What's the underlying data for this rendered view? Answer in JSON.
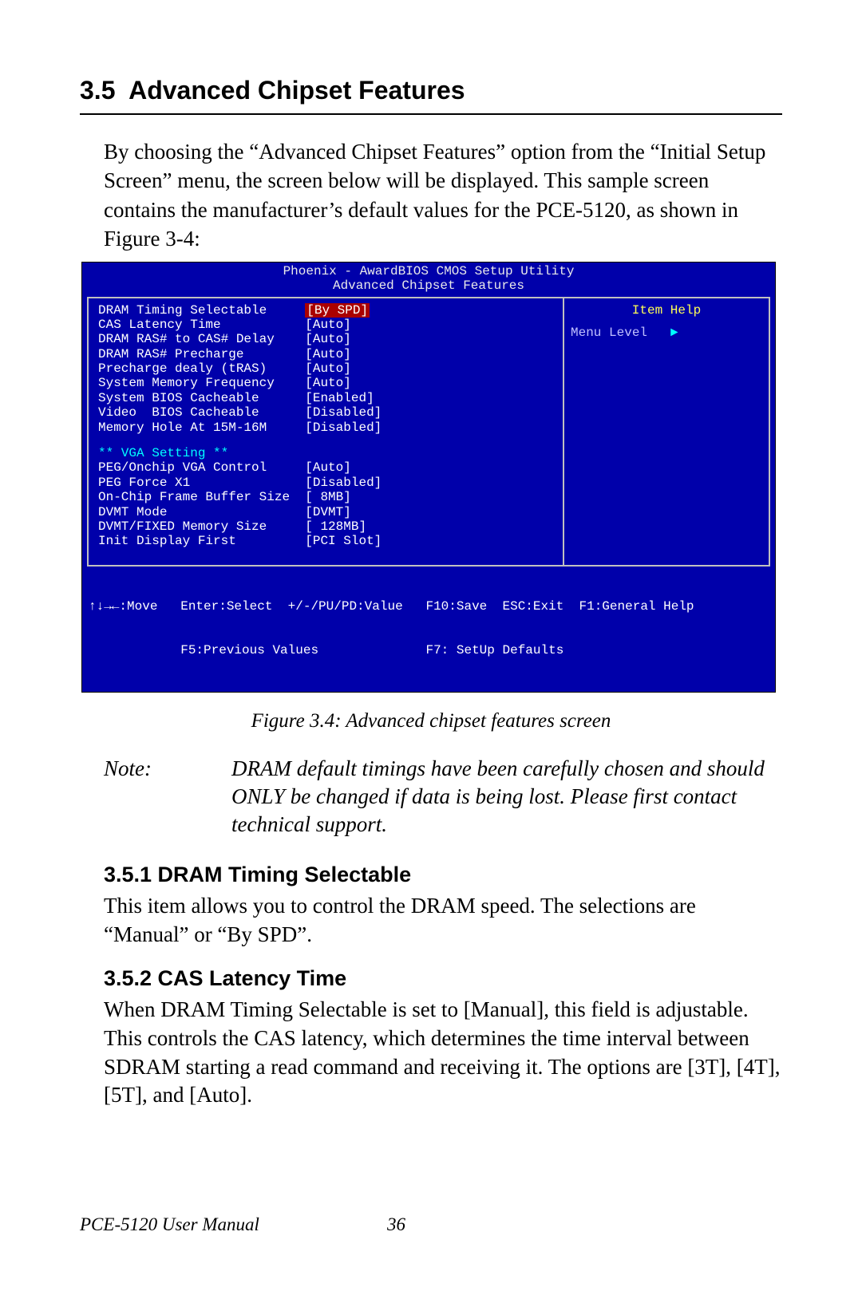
{
  "section": {
    "number": "3.5",
    "title": "Advanced Chipset Features"
  },
  "intro": "By choosing the “Advanced Chipset Features” option from the “Initial Setup Screen” menu, the screen below will be displayed. This sample screen contains the manufacturer’s default values for the PCE-5120, as shown in Figure 3-4:",
  "bios": {
    "title": "Phoenix - AwardBIOS CMOS Setup Utility",
    "subtitle": "Advanced Chipset Features",
    "settings1": [
      {
        "label": "DRAM Timing Selectable",
        "value": "[By SPD]",
        "hl": true
      },
      {
        "label": "CAS Latency Time",
        "value": "[Auto]"
      },
      {
        "label": "DRAM RAS# to CAS# Delay",
        "value": "[Auto]"
      },
      {
        "label": "DRAM RAS# Precharge",
        "value": "[Auto]"
      },
      {
        "label": "Precharge dealy (tRAS)",
        "value": "[Auto]"
      },
      {
        "label": "System Memory Frequency",
        "value": "[Auto]"
      },
      {
        "label": "System BIOS Cacheable",
        "value": "[Enabled]"
      },
      {
        "label": "Video  BIOS Cacheable",
        "value": "[Disabled]"
      },
      {
        "label": "Memory Hole At 15M-16M",
        "value": "[Disabled]"
      }
    ],
    "vga_header": "** VGA Setting **",
    "settings2": [
      {
        "label": "PEG/Onchip VGA Control",
        "value": "[Auto]"
      },
      {
        "label": "PEG Force X1",
        "value": "[Disabled]"
      },
      {
        "label": "On-Chip Frame Buffer Size",
        "value": "[ 8MB]"
      },
      {
        "label": "DVMT Mode",
        "value": "[DVMT]"
      },
      {
        "label": "DVMT/FIXED Memory Size",
        "value": "[ 128MB]"
      },
      {
        "label": "Init Display First",
        "value": "[PCI Slot]"
      }
    ],
    "help": {
      "item_help": "Item Help",
      "menu_level": "Menu Level"
    },
    "footer": {
      "line1": "↑↓→←:Move   Enter:Select  +/-/PU/PD:Value   F10:Save  ESC:Exit  F1:General Help",
      "line2": "            F5:Previous Values              F7: SetUp Defaults"
    }
  },
  "figure_caption": "Figure 3.4: Advanced chipset features screen",
  "note": {
    "label": "Note:",
    "body": "DRAM default timings have been carefully chosen and should ONLY be changed if data is being lost. Please first contact technical support."
  },
  "sub1": {
    "heading": "3.5.1 DRAM Timing Selectable",
    "body": "This item allows you to control the DRAM speed. The selections are “Manual” or “By SPD”."
  },
  "sub2": {
    "heading": "3.5.2 CAS Latency Time",
    "body": "When DRAM Timing Selectable is set to [Manual], this field is adjustable. This controls the CAS latency, which determines the time interval between SDRAM starting a read command and receiving it. The options are [3T], [4T], [5T], and [Auto]."
  },
  "footer": {
    "manual": "PCE-5120 User Manual",
    "page": "36"
  }
}
